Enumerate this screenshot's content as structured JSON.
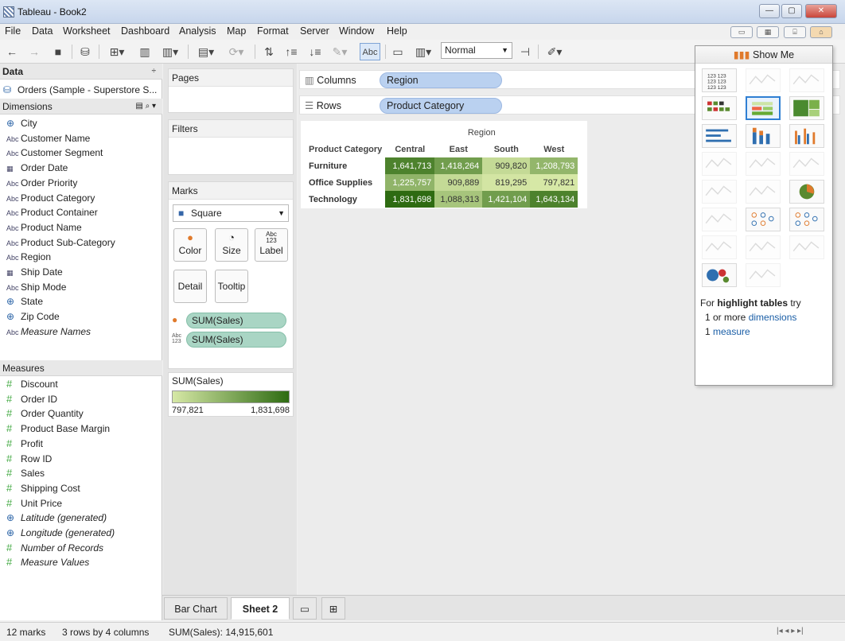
{
  "window": {
    "title": "Tableau - Book2",
    "buttons": [
      "—",
      "▢",
      "✕"
    ]
  },
  "menu": [
    "File",
    "Data",
    "Worksheet",
    "Dashboard",
    "Analysis",
    "Map",
    "Format",
    "Server",
    "Window",
    "Help"
  ],
  "toolbar": {
    "fit_mode": "Normal",
    "abc_label": "Abc"
  },
  "data_pane": {
    "header": "Data",
    "data_source": "Orders (Sample - Superstore S...",
    "dimensions_header": "Dimensions",
    "dimensions": [
      {
        "icon": "globe-icon",
        "label": "City"
      },
      {
        "icon": "abc-icon",
        "label": "Customer Name"
      },
      {
        "icon": "abc-icon",
        "label": "Customer Segment"
      },
      {
        "icon": "calendar-icon",
        "label": "Order Date"
      },
      {
        "icon": "abc-icon",
        "label": "Order Priority"
      },
      {
        "icon": "abc-icon",
        "label": "Product Category"
      },
      {
        "icon": "abc-icon",
        "label": "Product Container"
      },
      {
        "icon": "abc-icon",
        "label": "Product Name"
      },
      {
        "icon": "abc-icon",
        "label": "Product Sub-Category"
      },
      {
        "icon": "abc-icon",
        "label": "Region"
      },
      {
        "icon": "calendar-icon",
        "label": "Ship Date"
      },
      {
        "icon": "abc-icon",
        "label": "Ship Mode"
      },
      {
        "icon": "globe-icon",
        "label": "State"
      },
      {
        "icon": "globe-icon",
        "label": "Zip Code"
      },
      {
        "icon": "abc-icon",
        "label": "Measure Names"
      }
    ],
    "measures_header": "Measures",
    "measures": [
      {
        "icon": "hash-icon",
        "label": "Discount"
      },
      {
        "icon": "hash-icon",
        "label": "Order ID"
      },
      {
        "icon": "hash-icon",
        "label": "Order Quantity"
      },
      {
        "icon": "hash-icon",
        "label": "Product Base Margin"
      },
      {
        "icon": "hash-icon",
        "label": "Profit"
      },
      {
        "icon": "hash-icon",
        "label": "Row ID"
      },
      {
        "icon": "hash-icon",
        "label": "Sales"
      },
      {
        "icon": "hash-icon",
        "label": "Shipping Cost"
      },
      {
        "icon": "hash-icon",
        "label": "Unit Price"
      },
      {
        "icon": "globe-icon",
        "label": "Latitude (generated)"
      },
      {
        "icon": "globe-icon",
        "label": "Longitude (generated)"
      },
      {
        "icon": "hash-icon",
        "label": "Number of Records"
      },
      {
        "icon": "hash-icon",
        "label": "Measure Values"
      }
    ]
  },
  "shelves": {
    "pages": "Pages",
    "filters": "Filters",
    "marks": "Marks",
    "mark_type": "Square",
    "mark_buttons": [
      "Color",
      "Size",
      "Label",
      "Detail",
      "Tooltip"
    ],
    "mark_pills": [
      "SUM(Sales)",
      "SUM(Sales)"
    ],
    "legend_title": "SUM(Sales)",
    "legend_min": "797,821",
    "legend_max": "1,831,698",
    "columns_label": "Columns",
    "columns_pill": "Region",
    "rows_label": "Rows",
    "rows_pill": "Product Category"
  },
  "chart_data": {
    "type": "heatmap",
    "column_header": "Region",
    "row_header": "Product Category",
    "categories": [
      "Central",
      "East",
      "South",
      "West"
    ],
    "rows": [
      "Furniture",
      "Office Supplies",
      "Technology"
    ],
    "values": [
      [
        1641713,
        1418264,
        909820,
        1208793
      ],
      [
        1225757,
        909889,
        819295,
        797821
      ],
      [
        1831698,
        1088313,
        1421104,
        1643134
      ]
    ],
    "labels": [
      [
        "1,641,713",
        "1,418,264",
        "909,820",
        "1,208,793"
      ],
      [
        "1,225,757",
        "909,889",
        "819,295",
        "797,821"
      ],
      [
        "1,831,698",
        "1,088,313",
        "1,421,104",
        "1,643,134"
      ]
    ],
    "color_min": "#d6e8a6",
    "color_max": "#2e6b12",
    "vmin": 797821,
    "vmax": 1831698
  },
  "tabs": [
    "Bar Chart",
    "Sheet 2"
  ],
  "status": {
    "marks": "12 marks",
    "dims": "3 rows by 4 columns",
    "sum": "SUM(Sales): 14,915,601"
  },
  "show_me": {
    "title": "Show Me",
    "hint_prefix": "For ",
    "hint_bold": "highlight tables",
    "hint_suffix": " try",
    "line1_count": "1 or more ",
    "line1_link": "dimensions",
    "line2_count": "1 ",
    "line2_link": "measure"
  }
}
